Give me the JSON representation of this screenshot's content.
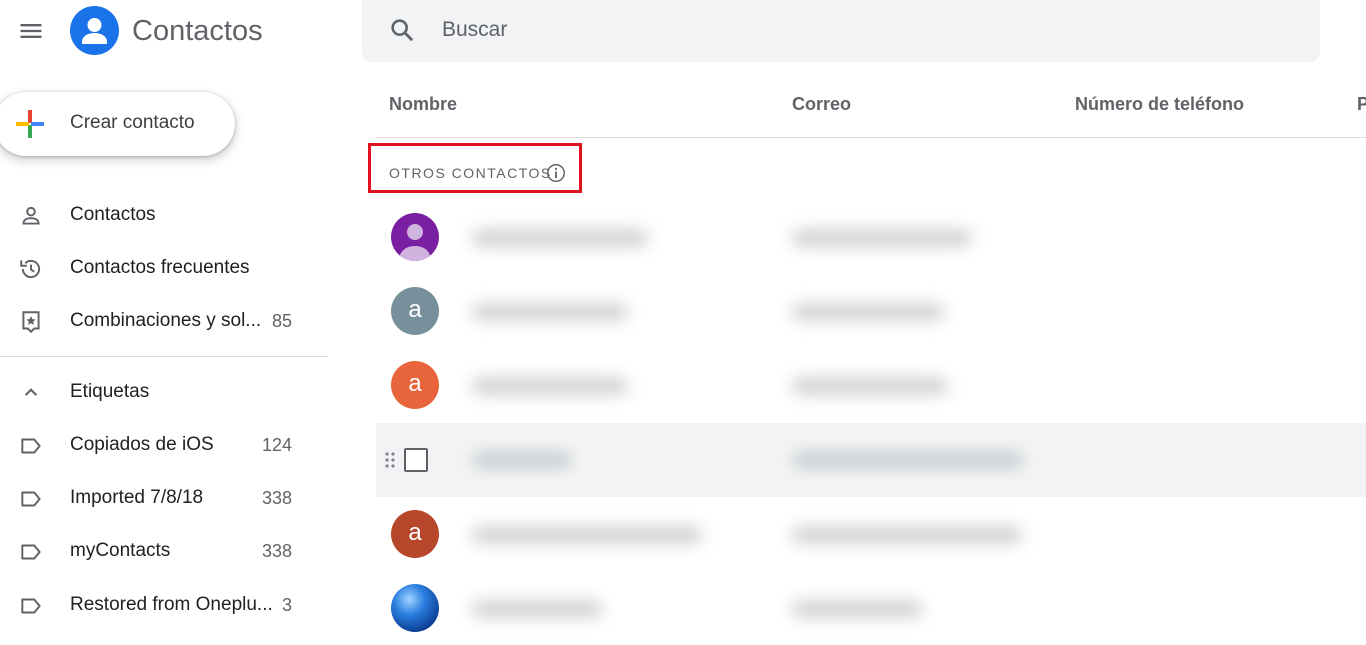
{
  "header": {
    "app_title": "Contactos",
    "menu_icon": "hamburger-menu-icon",
    "logo_icon": "person-account-icon"
  },
  "search": {
    "placeholder": "Buscar",
    "value": "",
    "icon": "search-icon"
  },
  "create_button": {
    "label": "Crear contacto",
    "icon": "google-plus-icon",
    "plus_colors": [
      "#ea4335",
      "#4285f4",
      "#34a853",
      "#fbbc04"
    ]
  },
  "sidebar": {
    "items": [
      {
        "label": "Contactos",
        "icon": "person-icon",
        "count": ""
      },
      {
        "label": "Contactos frecuentes",
        "icon": "history-icon",
        "count": ""
      },
      {
        "label": "Combinaciones y sol...",
        "icon": "merge-suggestions-icon",
        "count": "85"
      }
    ],
    "labels_section": {
      "label": "Etiquetas",
      "icon": "chevron-up-icon",
      "expanded": true
    },
    "labels": [
      {
        "label": "Copiados de iOS",
        "icon": "label-icon",
        "count": "124"
      },
      {
        "label": "Imported 7/8/18",
        "icon": "label-icon",
        "count": "338"
      },
      {
        "label": "myContacts",
        "icon": "label-icon",
        "count": "338"
      },
      {
        "label": "Restored from Oneplu...",
        "icon": "label-icon",
        "count": "3"
      }
    ]
  },
  "table": {
    "columns": [
      "Nombre",
      "Correo",
      "Número de teléfono",
      "P"
    ],
    "section_header": {
      "label": "OTROS CONTACTOS",
      "icon": "info-icon",
      "highlight_color": "#e0121f"
    },
    "rows": [
      {
        "avatar_type": "person",
        "avatar_letter": "",
        "avatar_color": "#7b1fa2",
        "hover": false
      },
      {
        "avatar_type": "letter",
        "avatar_letter": "a",
        "avatar_color": "#78909c",
        "hover": false
      },
      {
        "avatar_type": "letter",
        "avatar_letter": "a",
        "avatar_color": "#e8643a",
        "hover": false
      },
      {
        "avatar_type": "checkbox",
        "avatar_letter": "",
        "avatar_color": "",
        "hover": true
      },
      {
        "avatar_type": "letter",
        "avatar_letter": "a",
        "avatar_color": "#b7472a",
        "hover": false
      },
      {
        "avatar_type": "photo-globe",
        "avatar_letter": "",
        "avatar_color": "#1565c0",
        "hover": false
      }
    ]
  },
  "colors": {
    "accent": "#1a73e8",
    "text_secondary": "#5f6368",
    "divider": "#dadce0",
    "search_bg": "#f1f3f4"
  }
}
